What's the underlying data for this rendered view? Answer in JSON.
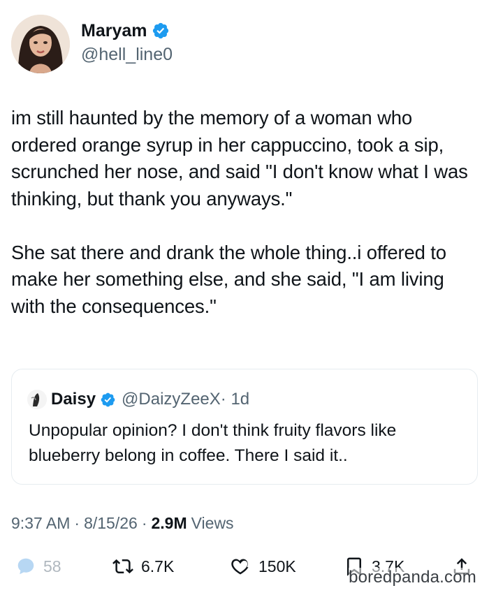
{
  "author": {
    "display_name": "Maryam",
    "handle": "@hell_line0"
  },
  "tweet": {
    "text": "im still haunted by the memory of a woman who ordered orange syrup in her cappuccino, took a sip, scrunched her nose, and said \"I don't know what I was thinking, but thank you anyways.\"\n\nShe sat there and drank the whole thing..i offered to make her something else, and she said, \"I am living with the consequences.\""
  },
  "quoted": {
    "display_name": "Daisy",
    "handle": "@DaizyZeeX",
    "time": "· 1d",
    "text": "Unpopular opinion? I don't think fruity flavors like blueberry belong in coffee. There I said it.."
  },
  "meta": {
    "time": "9:37 AM",
    "sep1": "·",
    "date": "8/15/26",
    "sep2": "·",
    "views_count": "2.9M",
    "views_label": "Views"
  },
  "actions": {
    "replies": "58",
    "reposts": "6.7K",
    "likes": "150K",
    "bookmarks": "3.7K"
  },
  "icons": {
    "verified": "verified-badge-icon",
    "reply": "reply-icon",
    "repost": "repost-icon",
    "like": "heart-icon",
    "bookmark": "bookmark-icon",
    "share": "share-icon"
  },
  "colors": {
    "verified": "#1d9bf0",
    "text": "#0f1419",
    "secondary": "#536471"
  },
  "watermark": "boredpanda.com"
}
